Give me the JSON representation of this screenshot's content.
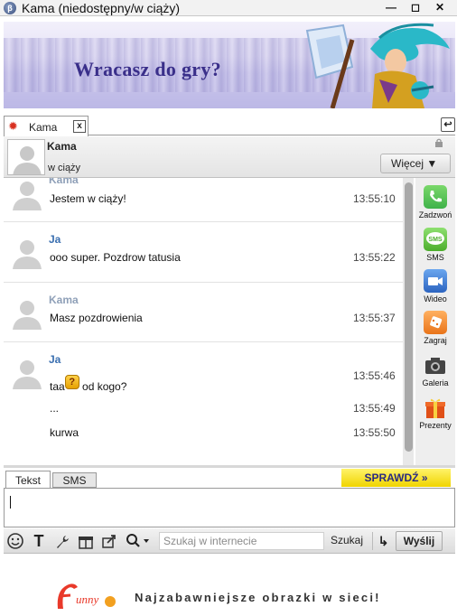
{
  "window": {
    "title": "Kama (niedostępny/w ciąży)",
    "app_icon_letter": "β"
  },
  "banner": {
    "text": "Wracasz do gry?"
  },
  "tabs": [
    {
      "label": "Kama",
      "close_glyph": "x"
    }
  ],
  "contact": {
    "name": "Kama",
    "status": "w ciąży",
    "more_label": "Więcej ▼"
  },
  "messages": [
    {
      "sender": "Kama",
      "lines": [
        {
          "text": "Jestem w ciąży!",
          "time": "13:55:10"
        }
      ]
    },
    {
      "sender": "Ja",
      "lines": [
        {
          "text": "ooo super. Pozdrow tatusia",
          "time": "13:55:22"
        }
      ]
    },
    {
      "sender": "Kama",
      "lines": [
        {
          "text": "Masz pozdrowienia",
          "time": "13:55:37"
        }
      ]
    },
    {
      "sender": "Ja",
      "lines": [
        {
          "text_before": "taa",
          "emoticon": "?",
          "text_after": " od kogo?",
          "time": "13:55:46"
        },
        {
          "text": "...",
          "time": "13:55:49"
        },
        {
          "text": "kurwa",
          "time": "13:55:50"
        }
      ]
    }
  ],
  "actions": [
    {
      "label": "Zadzwoń",
      "icon": "phone-icon",
      "color": "#3fb24a"
    },
    {
      "label": "SMS",
      "icon": "sms-icon",
      "color": "#5bbf3c"
    },
    {
      "label": "Wideo",
      "icon": "video-icon",
      "color": "#3a78d0"
    },
    {
      "label": "Zagraj",
      "icon": "game-icon",
      "color": "#f08a2a"
    },
    {
      "label": "Galeria",
      "icon": "camera-icon",
      "color": "#555555"
    },
    {
      "label": "Prezenty",
      "icon": "gift-icon",
      "color": "#e05018"
    }
  ],
  "input": {
    "tab_text": "Tekst",
    "tab_sms": "SMS",
    "check_label": "SPRAWDŹ »"
  },
  "toolbar": {
    "search_placeholder": "Szukaj w internecie",
    "search_label": "Szukaj",
    "send_label": "Wyślij"
  },
  "footer": {
    "logo_text": "Funny",
    "tagline": "Najzabawniejsze obrazki w sieci!"
  }
}
